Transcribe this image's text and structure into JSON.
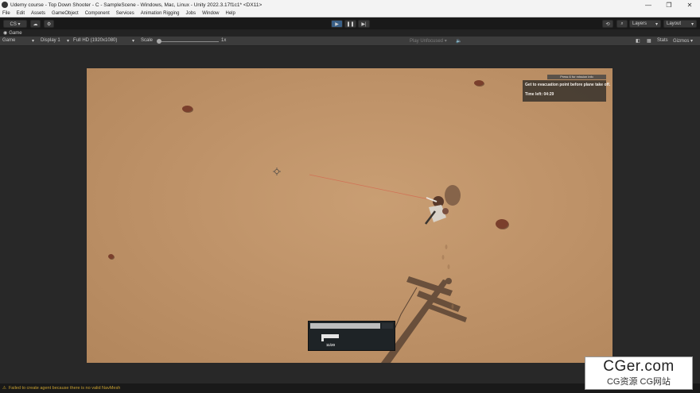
{
  "window": {
    "title": "Udemy course - Top Down Shooter - C - SampleScene - Windows, Mac, Linux - Unity 2022.3.17f1c1* <DX11>",
    "controls": [
      "—",
      "❐",
      "✕"
    ]
  },
  "menu": [
    "File",
    "Edit",
    "Assets",
    "GameObject",
    "Component",
    "Services",
    "Animation Rigging",
    "Jobs",
    "Window",
    "Help"
  ],
  "toolbar": {
    "account_label": "CS ▾",
    "play_icon": "▶",
    "pause_icon": "❚❚",
    "step_icon": "▶|",
    "layers_label": "Layers",
    "layout_label": "Layout"
  },
  "tab": {
    "label": "Game"
  },
  "game_bar": {
    "view_label": "Game",
    "display_label": "Display 1",
    "resolution_label": "Full HD (1920x1080)",
    "scale_label": "Scale",
    "scale_value": "1x",
    "play_focus_label": "Play Unfocused",
    "stats_label": "Stats",
    "gizmos_label": "Gizmos"
  },
  "hud": {
    "hint": "Press 6 for mission info",
    "objective": "Get to evacuation point before plane take off.",
    "time_left": "Time left: 04:29",
    "ammo": "11/20"
  },
  "status": {
    "message": "Failed to create agent because there is no valid NavMesh"
  },
  "watermark": {
    "main": "CGer.com",
    "sub": "CG资源  CG网站"
  }
}
